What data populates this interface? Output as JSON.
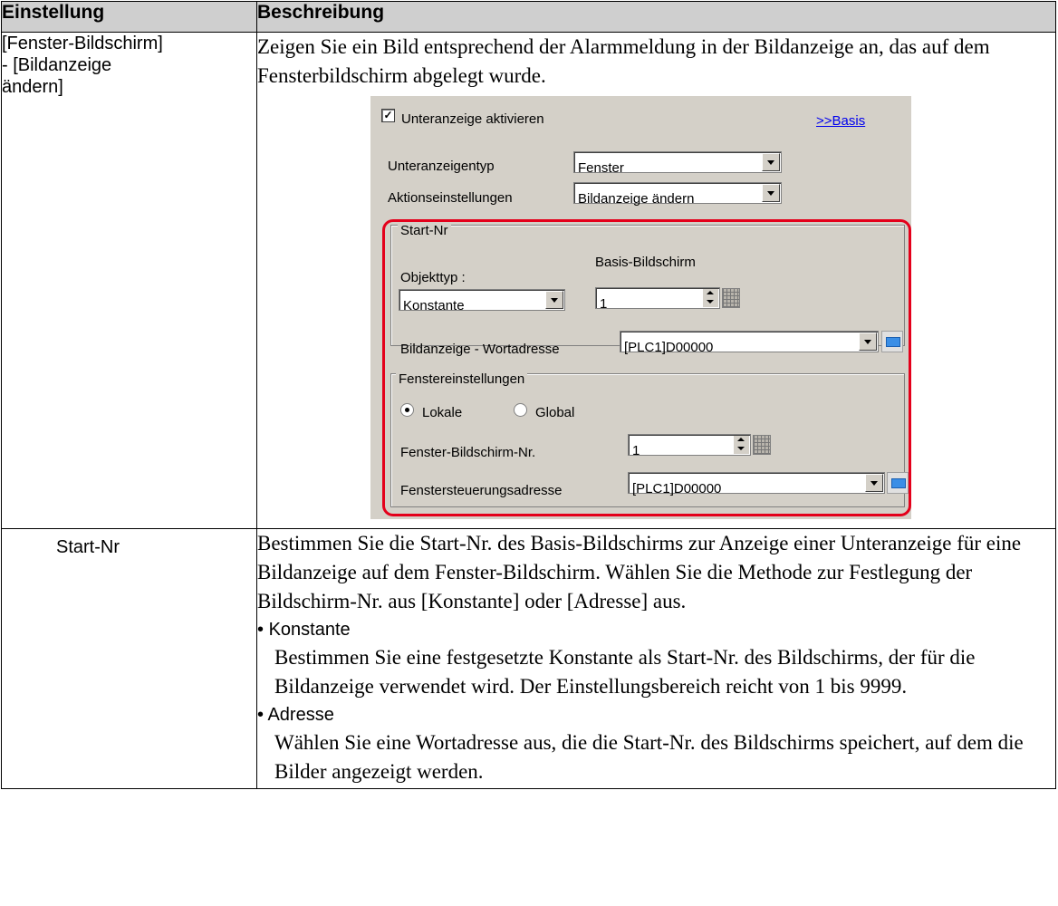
{
  "table": {
    "header_left": "Einstellung",
    "header_right": "Beschreibung"
  },
  "row1": {
    "setting_line1": "[Fenster-Bildschirm]",
    "setting_line2": "- [Bildanzeige",
    "setting_line3": "ändern]",
    "description": "Zeigen Sie ein Bild entsprechend der Alarmmeldung in der Bildanzeige an, das auf dem Fensterbildschirm  abgelegt wurde."
  },
  "dialog": {
    "enable_checkbox_label": "Unteranzeige aktivieren",
    "enable_checked": true,
    "basis_link": ">>Basis",
    "subdisplay_type_label": "Unteranzeigentyp",
    "subdisplay_type_value": "Fenster",
    "action_settings_label": "Aktionseinstellungen",
    "action_settings_value": "Bildanzeige ändern",
    "start_group_label": "Start-Nr",
    "object_type_label": "Objekttyp :",
    "object_type_value": "Konstante",
    "base_screen_label": "Basis-Bildschirm",
    "base_screen_value": "1",
    "word_address_label": "Bildanzeige - Wortadresse",
    "word_address_value": "[PLC1]D00000",
    "window_settings_group_label": "Fenstereinstellungen",
    "radio_local_label": "Lokale",
    "radio_global_label": "Global",
    "selected_radio": "Lokale",
    "window_screen_no_label": "Fenster-Bildschirm-Nr.",
    "window_screen_no_value": "1",
    "window_control_address_label": "Fenstersteuerungsadresse",
    "window_control_address_value": "[PLC1]D00000",
    "highlight_color": "#e4001b"
  },
  "row2": {
    "setting": "Start-Nr",
    "description": "Bestimmen Sie die Start-Nr. des Basis-Bildschirms zur Anzeige einer Unteranzeige für eine Bildanzeige auf dem Fenster-Bildschirm. Wählen Sie die Methode zur Festlegung der Bildschirm-Nr. aus [Konstante] oder [Adresse] aus.",
    "bullet1_title": "Konstante",
    "bullet1_text": "Bestimmen Sie eine festgesetzte Konstante als Start-Nr. des Bildschirms, der für die Bildanzeige verwendet wird. Der Einstellungsbereich reicht von 1 bis 9999.",
    "bullet2_title": "Adresse",
    "bullet2_text": "Wählen Sie eine Wortadresse aus, die die Start-Nr. des Bildschirms speichert, auf dem die Bilder angezeigt werden."
  }
}
